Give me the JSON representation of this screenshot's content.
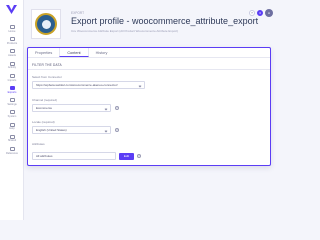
{
  "sidebar": {
    "items": [
      {
        "label": "Home",
        "icon": "home-icon"
      },
      {
        "label": "Products",
        "icon": "products-icon"
      },
      {
        "label": "Assets",
        "icon": "assets-icon"
      },
      {
        "label": "Activity",
        "icon": "activity-icon"
      },
      {
        "label": "Imports",
        "icon": "imports-icon"
      },
      {
        "label": "Exports",
        "icon": "exports-icon"
      },
      {
        "label": "Settings",
        "icon": "settings-icon"
      },
      {
        "label": "System",
        "icon": "system-icon"
      },
      {
        "label": "Help",
        "icon": "help-icon"
      },
      {
        "label": "Shared",
        "icon": "shared-icon"
      },
      {
        "label": "Reference",
        "icon": "reference-icon"
      }
    ],
    "active_index": 5,
    "accent_color": "#5b3df5"
  },
  "header": {
    "label": "EXPORT",
    "title": "Export profile - woocommerce_attribute_export",
    "path": "Csv Woocommerce Attribute Export (All Product Woocommerce Attribute Export)",
    "help_label": "?",
    "count_label": "3",
    "avatar_label": "A"
  },
  "tabs": [
    {
      "label": "Properties"
    },
    {
      "label": "Content"
    },
    {
      "label": "History"
    }
  ],
  "active_tab": 1,
  "content": {
    "section_title": "FILTER THE DATA",
    "fields": [
      {
        "label": "Select from Connector",
        "value": "https://wpbeta.webkul.com/woocommerce-akeneo-connector/"
      },
      {
        "label": "Channel (required)",
        "value": "Ecommerce"
      },
      {
        "label": "Locale (required)",
        "value": "English (United States)"
      },
      {
        "label": "Attributes",
        "value": "All attributes"
      }
    ],
    "edit_button": "Edit",
    "help_glyph": "?"
  }
}
